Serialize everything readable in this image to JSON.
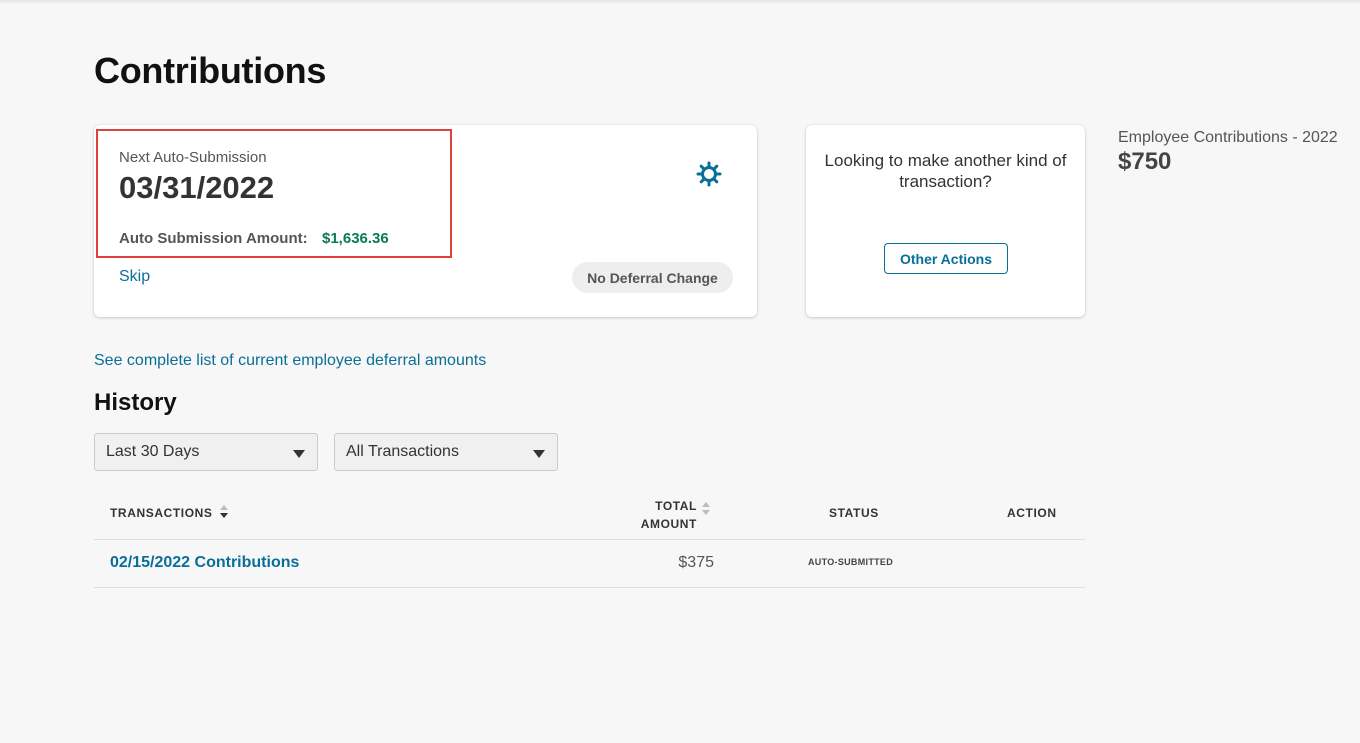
{
  "page": {
    "title": "Contributions"
  },
  "auto_submission": {
    "label": "Next Auto-Submission",
    "date": "03/31/2022",
    "amount_label": "Auto Submission Amount:",
    "amount_value": "$1,636.36",
    "amount_color": "#0a7a5a",
    "skip_label": "Skip",
    "settings_icon": "gear-icon",
    "deferral_badge": "No Deferral Change"
  },
  "other_actions": {
    "question": "Looking to make another kind of transaction?",
    "button_label": "Other Actions"
  },
  "employee_contributions": {
    "label": "Employee Contributions - 2022",
    "value": "$750"
  },
  "deferral_link": "See complete list of current employee deferral amounts",
  "history": {
    "title": "History",
    "filters": {
      "range": "Last 30 Days",
      "type": "All Transactions"
    },
    "columns": {
      "transactions": "TRANSACTIONS",
      "total_amount": "TOTAL AMOUNT",
      "status": "STATUS",
      "action": "ACTION"
    },
    "rows": [
      {
        "transaction": "02/15/2022 Contributions",
        "amount": "$375",
        "status": "AUTO-SUBMITTED",
        "action": ""
      }
    ]
  },
  "colors": {
    "accent": "#0a6f98",
    "highlight": "#e0403a",
    "background": "#f7f7f7"
  }
}
